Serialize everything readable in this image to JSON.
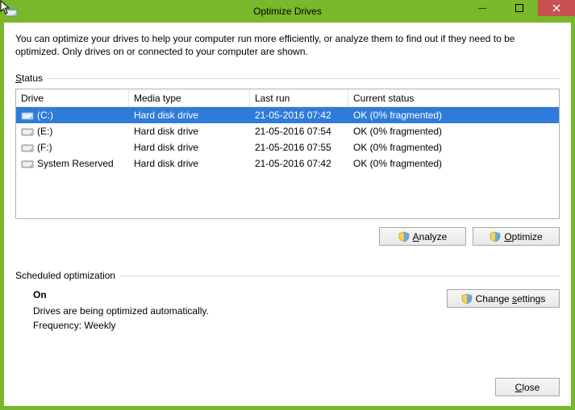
{
  "window": {
    "title": "Optimize Drives"
  },
  "intro": "You can optimize your drives to help your computer run more efficiently, or analyze them to find out if they need to be optimized. Only drives on or connected to your computer are shown.",
  "status_label_prefix": "S",
  "status_label_rest": "tatus",
  "columns": {
    "drive": "Drive",
    "media": "Media type",
    "last": "Last run",
    "status": "Current status"
  },
  "drives": [
    {
      "name": "(C:)",
      "media": "Hard disk drive",
      "last": "21-05-2016 07:42",
      "status": "OK (0% fragmented)",
      "selected": true
    },
    {
      "name": "(E:)",
      "media": "Hard disk drive",
      "last": "21-05-2016 07:54",
      "status": "OK (0% fragmented)",
      "selected": false
    },
    {
      "name": "(F:)",
      "media": "Hard disk drive",
      "last": "21-05-2016 07:55",
      "status": "OK (0% fragmented)",
      "selected": false
    },
    {
      "name": "System Reserved",
      "media": "Hard disk drive",
      "last": "21-05-2016 07:42",
      "status": "OK (0% fragmented)",
      "selected": false
    }
  ],
  "buttons": {
    "analyze_prefix": "A",
    "analyze_rest": "nalyze",
    "optimize_prefix": "O",
    "optimize_rest": "ptimize",
    "change_prefix": "Change ",
    "change_accel": "s",
    "change_rest": "ettings",
    "close_prefix": "C",
    "close_rest": "lose"
  },
  "sched": {
    "label": "Scheduled optimization",
    "on": "On",
    "msg": "Drives are being optimized automatically.",
    "freq": "Frequency: Weekly"
  }
}
